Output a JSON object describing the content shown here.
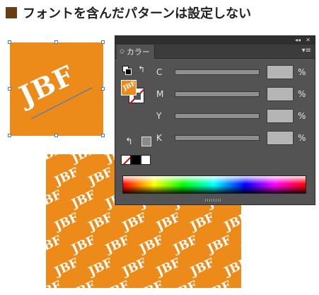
{
  "heading": {
    "text": "フォントを含んだパターンは設定しない"
  },
  "sample": {
    "text": "JBF"
  },
  "pattern": {
    "tile_text": "JBF"
  },
  "color_panel": {
    "tab_label": "カラー",
    "channels": [
      {
        "label": "C",
        "value": "",
        "unit": "%"
      },
      {
        "label": "M",
        "value": "",
        "unit": "%"
      },
      {
        "label": "Y",
        "value": "",
        "unit": "%"
      },
      {
        "label": "K",
        "value": "",
        "unit": "%"
      }
    ]
  },
  "colors": {
    "orange": "#ec8a1a",
    "panel": "#535353",
    "selection": "#4a78c9"
  },
  "icons": [
    "collapse-icon",
    "close-icon",
    "panel-menu-icon",
    "default-colors-icon",
    "swap-icon",
    "out-of-gamut-icon",
    "web-safe-icon",
    "resize-grip-icon"
  ]
}
